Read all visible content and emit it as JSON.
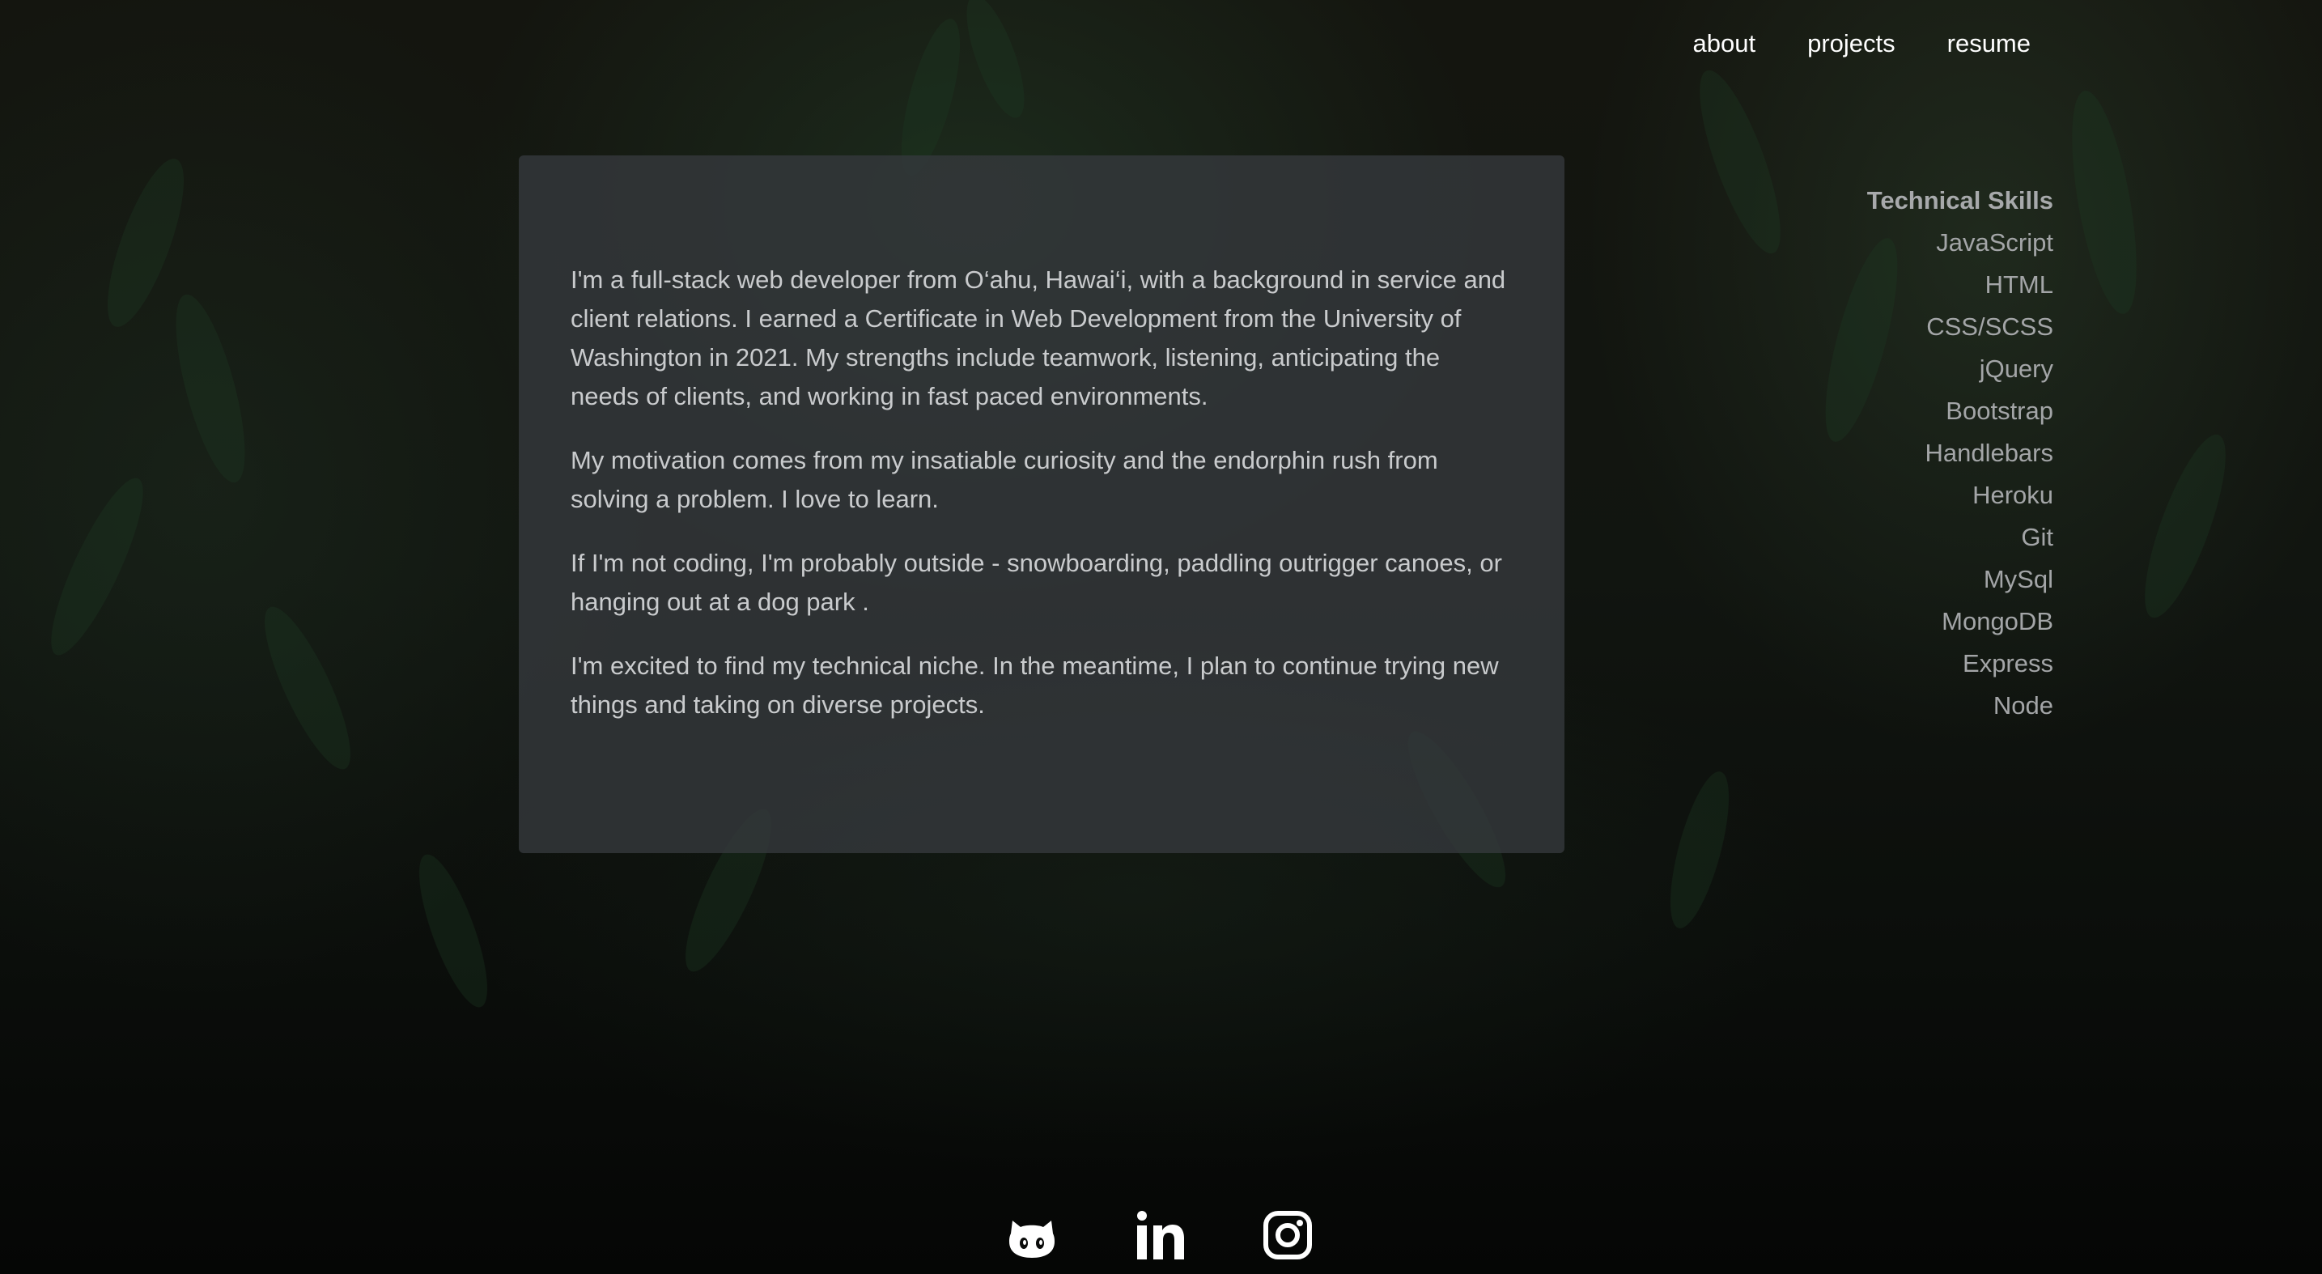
{
  "nav": {
    "links": [
      {
        "label": "about"
      },
      {
        "label": "projects"
      },
      {
        "label": "resume"
      }
    ]
  },
  "about": {
    "paragraphs": [
      "I'm a full-stack web developer from O‘ahu, Hawai‘i, with a background in service and client relations. I earned a Certificate in Web Development from the University of Washington in 2021. My strengths include teamwork, listening, anticipating the needs of clients, and working in fast paced environments.",
      "My motivation comes from my insatiable curiosity and the endorphin rush from solving a problem. I love to learn.",
      "If I'm not coding, I'm probably outside - snowboarding, paddling outrigger canoes, or hanging out at a dog park .",
      "I'm excited to find my technical niche. In the meantime, I plan to continue trying new things and taking on diverse projects."
    ]
  },
  "skills": {
    "title": "Technical Skills",
    "items": [
      "JavaScript",
      "HTML",
      "CSS/SCSS",
      "jQuery",
      "Bootstrap",
      "Handlebars",
      "Heroku",
      "Git",
      "MySql",
      "MongoDB",
      "Express",
      "Node"
    ]
  },
  "social": {
    "icons": [
      "github-icon",
      "linkedin-icon",
      "instagram-icon"
    ]
  },
  "colors": {
    "card_background": "#34383c",
    "text_light": "#c9cbcd",
    "nav_text": "#ffffff"
  }
}
